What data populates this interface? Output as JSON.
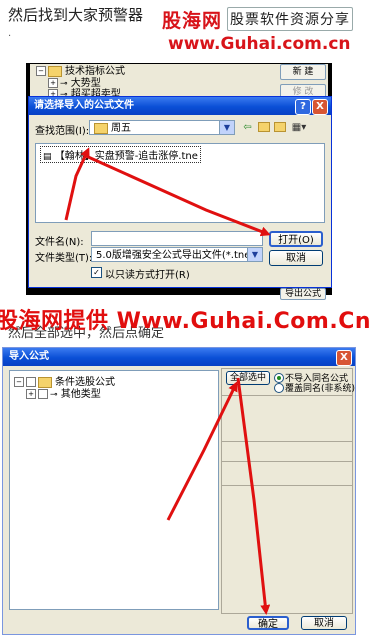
{
  "doc": {
    "intro_text": "然后找到大家预警器",
    "bullet_1": ".",
    "second_text": "然后全部选中，然后点确定",
    "watermark_text": "股海网提供 Www.Guhai.Com.Cn"
  },
  "logo": {
    "cn_name": "股海网",
    "tagline": "股票软件资源分享",
    "url": "www.Guhai.com.cn"
  },
  "bg_window": {
    "tree_items": [
      "技术指标公式",
      "大势型",
      "超买超卖型"
    ],
    "side_buttons": [
      "新 建",
      "修 改",
      "导出公式"
    ]
  },
  "open_dialog": {
    "title": "请选择导入的公式文件",
    "help_btn": "?",
    "close_btn": "X",
    "lookin_label": "查找范围(I):",
    "lookin_value": "周五",
    "file_item": "【翰林】实盘预警-追击涨停.tne",
    "filename_label": "文件名(N):",
    "filename_value": "",
    "filetype_label": "文件类型(T):",
    "filetype_value": "5.0版增强安全公式导出文件(*.tne)",
    "readonly_label": "以只读方式打开(R)",
    "readonly_checked": "✓",
    "open_button": "打开(O)",
    "cancel_button": "取消"
  },
  "import_dialog": {
    "title": "导入公式",
    "close_btn": "X",
    "tree_items": [
      "条件选股公式",
      "其他类型"
    ],
    "select_all_button": "全部选中",
    "radio_options": [
      "不导入同名公式",
      "覆盖同名(非系统)"
    ],
    "ok_button": "确定",
    "cancel_button": "取消"
  },
  "colors": {
    "brand_red": "#d8141a",
    "xp_title_blue": "#0a4fd6",
    "arrow_red": "#e01010",
    "dialog_bg": "#ece9d8"
  }
}
